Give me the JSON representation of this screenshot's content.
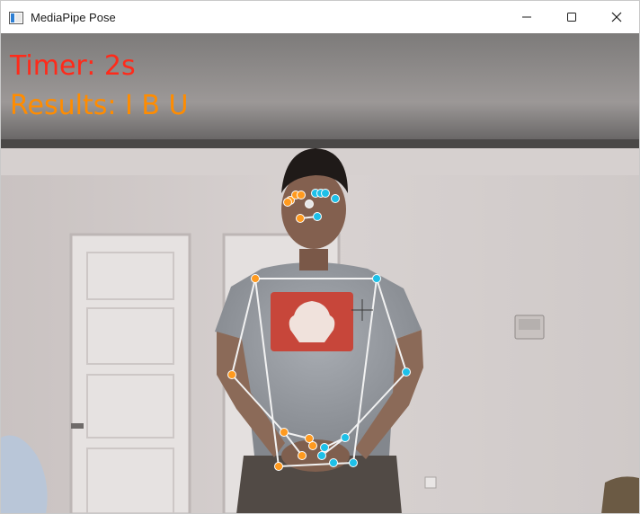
{
  "window": {
    "title": "MediaPipe Pose",
    "controls": [
      "minimize",
      "maximize",
      "close"
    ]
  },
  "overlay": {
    "timer_text": "Timer: 2s",
    "timer_color": "#ff2a1a",
    "results_text": "Results: I B U",
    "results_color": "#ff8c00"
  },
  "landmark_colors": {
    "left": "#ff9a1f",
    "right": "#1ec0e8",
    "center": "#e6e6e6",
    "connection": "#f2f2f2"
  }
}
